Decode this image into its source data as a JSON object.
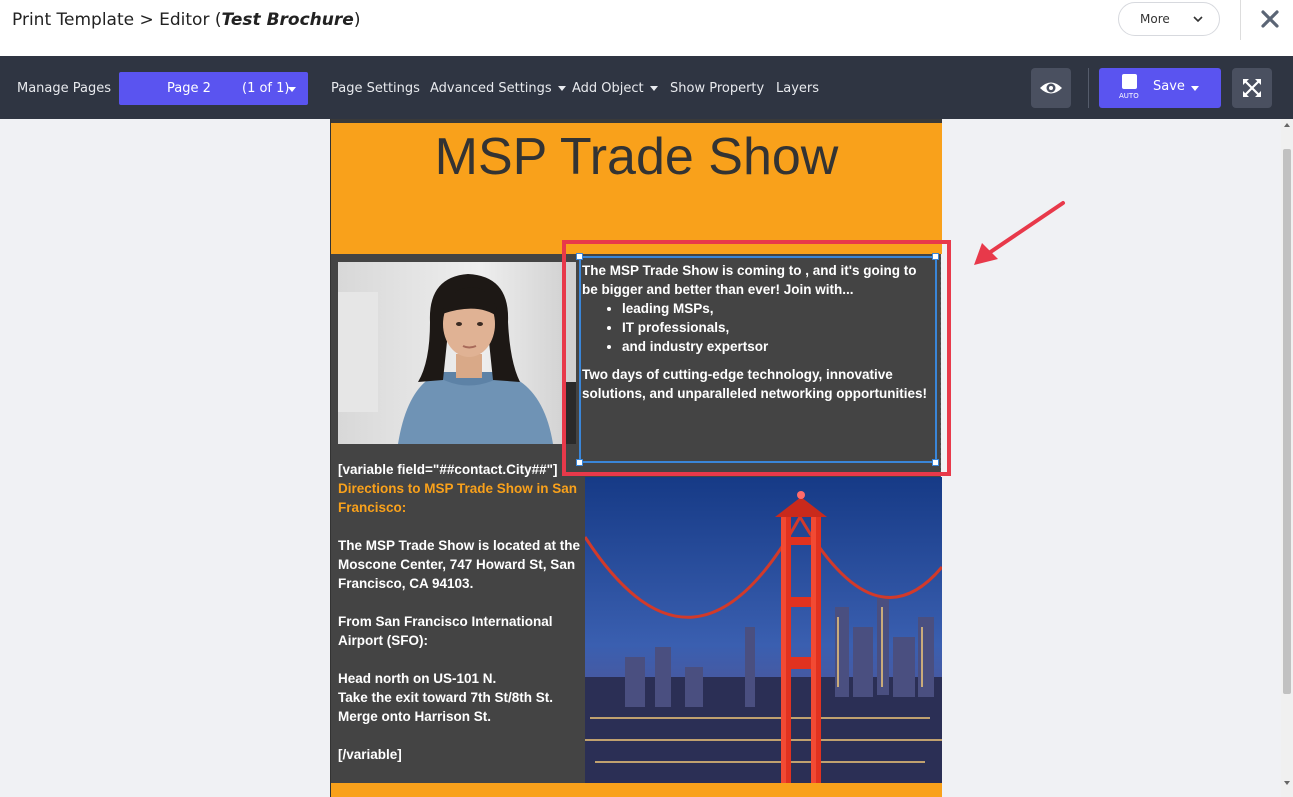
{
  "header": {
    "title_prefix": "Print Template > Editor (",
    "template_name": "Test Brochure",
    "title_suffix": ")",
    "more_label": "More"
  },
  "toolbar": {
    "manage_pages": "Manage Pages",
    "page_name": "Page 2",
    "page_count": "(1 of 1)",
    "page_settings": "Page Settings",
    "advanced_settings": "Advanced Settings",
    "add_object": "Add Object",
    "show_property": "Show Property",
    "layers": "Layers",
    "auto_label": "AUTO",
    "save_label": "Save"
  },
  "document": {
    "headline": "MSP Trade Show",
    "text_box": {
      "intro": "The MSP Trade Show is coming to , and it's going to be bigger and better than ever! Join with...",
      "bullets": [
        "leading MSPs,",
        "IT professionals,",
        "and industry expertsor"
      ],
      "closing": "Two days of cutting-edge technology, innovative solutions, and unparalleled networking opportunities!"
    },
    "left_column": {
      "variable_open": "[variable field=\"##contact.City##\"]",
      "directions_title": "Directions to MSP Trade Show in San Francisco:",
      "location": "The MSP Trade Show is located at the Moscone Center, 747 Howard St, San Francisco, CA 94103.",
      "from_airport": "From San Francisco International Airport (SFO):",
      "step1": "Head north on US-101 N.",
      "step2": "Take the exit toward 7th St/8th St.",
      "step3": "Merge onto Harrison St.",
      "variable_close": "[/variable]"
    }
  },
  "colors": {
    "accent": "#5a54f0",
    "toolbar_bg": "#2f3542",
    "banner": "#f9a11b",
    "highlight": "#e8394a",
    "selection": "#3a86d8"
  }
}
